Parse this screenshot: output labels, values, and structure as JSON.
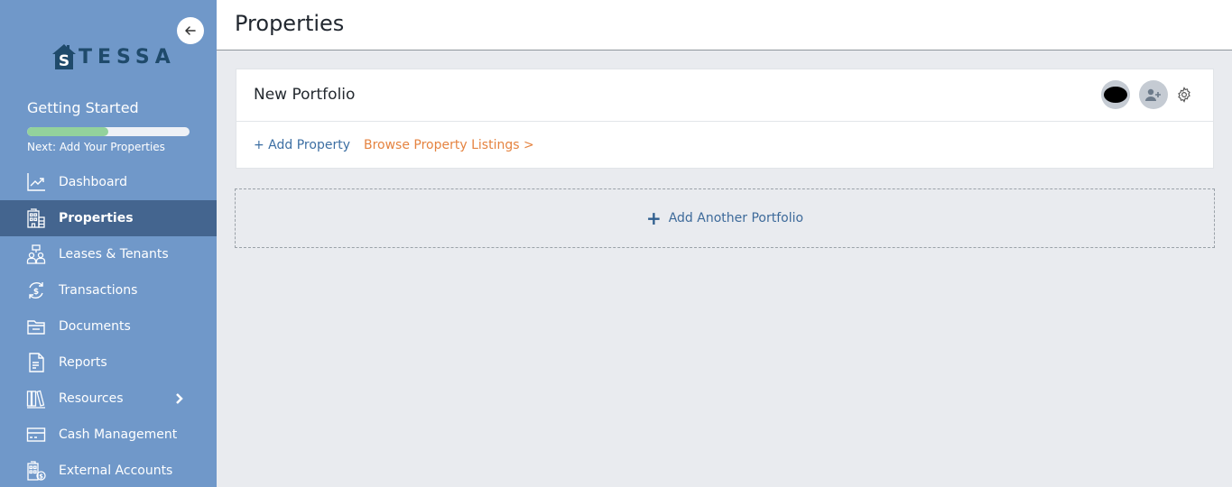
{
  "sidebar": {
    "logo_text": "TESSA",
    "logo_letter": "S",
    "getting_started": {
      "title": "Getting Started",
      "progress_percent": 50,
      "next_label": "Next: Add Your Properties"
    },
    "items": [
      {
        "label": "Dashboard",
        "icon": "chart-line-icon",
        "active": false
      },
      {
        "label": "Properties",
        "icon": "building-icon",
        "active": true
      },
      {
        "label": "Leases & Tenants",
        "icon": "tenants-icon",
        "active": false
      },
      {
        "label": "Transactions",
        "icon": "dollar-cycle-icon",
        "active": false
      },
      {
        "label": "Documents",
        "icon": "folder-icon",
        "active": false
      },
      {
        "label": "Reports",
        "icon": "document-icon",
        "active": false
      },
      {
        "label": "Resources",
        "icon": "books-icon",
        "active": false,
        "has_submenu": true
      },
      {
        "label": "Cash Management",
        "icon": "card-icon",
        "active": false
      },
      {
        "label": "External Accounts",
        "icon": "building-dollar-icon",
        "active": false
      }
    ],
    "colors": {
      "background": "#7098c9",
      "active": "#44658f",
      "progress": "#93d29c"
    }
  },
  "header": {
    "title": "Properties"
  },
  "portfolio": {
    "name": "New Portfolio",
    "add_property_label": "+ Add Property",
    "browse_listings_label": "Browse Property Listings >"
  },
  "add_portfolio": {
    "plus": "+",
    "label": "Add Another Portfolio"
  },
  "colors": {
    "link_blue": "#3d6fa3",
    "link_orange": "#e58340"
  }
}
